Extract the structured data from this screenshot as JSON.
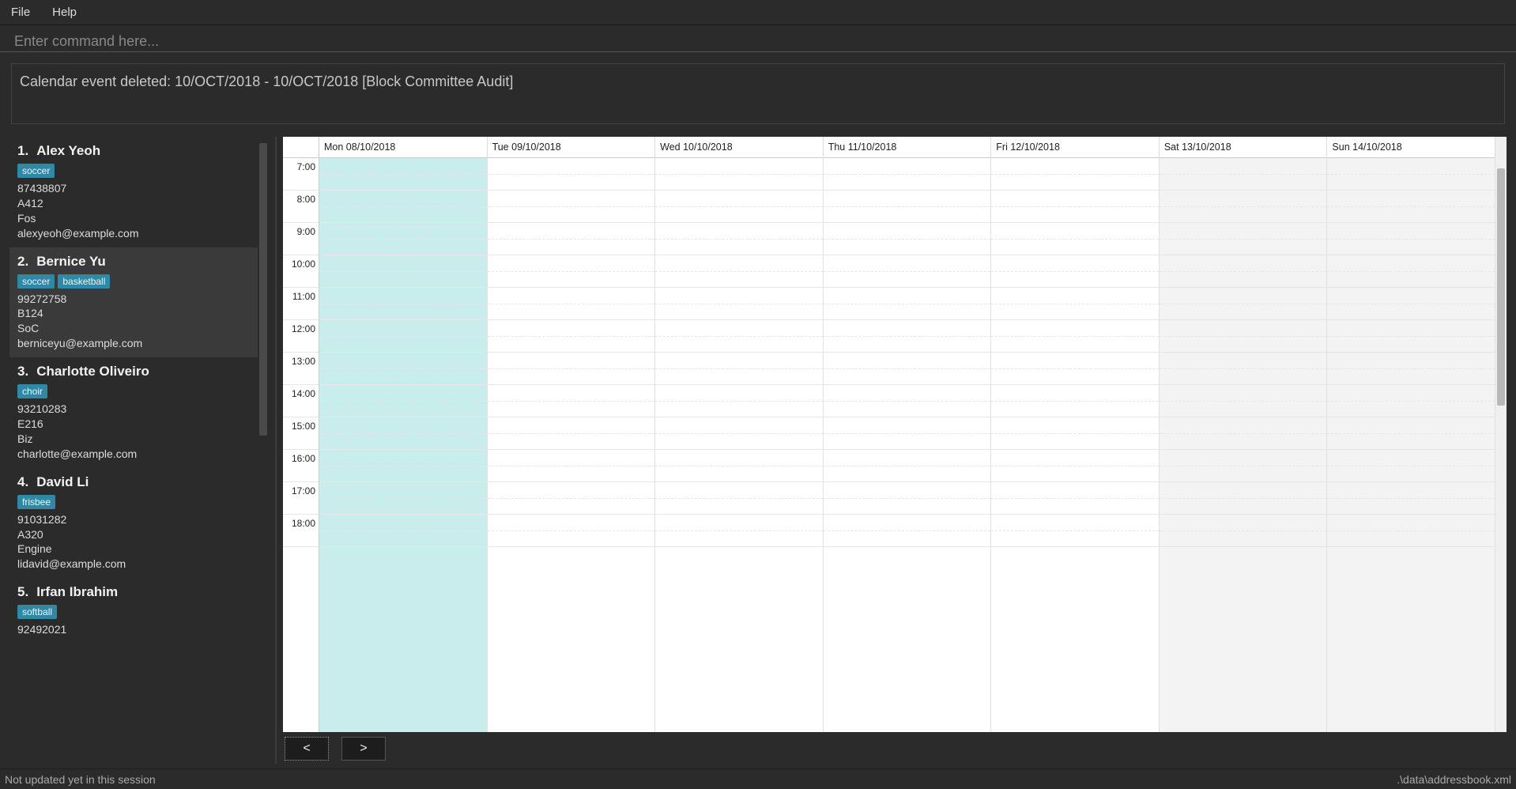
{
  "menu": {
    "file": "File",
    "help": "Help"
  },
  "command": {
    "placeholder": "Enter command here..."
  },
  "status": "Calendar event deleted: 10/OCT/2018 - 10/OCT/2018 [Block Committee Audit]",
  "people": [
    {
      "idx": "1.",
      "name": "Alex Yeoh",
      "tags": [
        "soccer"
      ],
      "phone": "87438807",
      "room": "A412",
      "faculty": "Fos",
      "email": "alexyeoh@example.com",
      "selected": false
    },
    {
      "idx": "2.",
      "name": "Bernice Yu",
      "tags": [
        "soccer",
        "basketball"
      ],
      "phone": "99272758",
      "room": "B124",
      "faculty": "SoC",
      "email": "berniceyu@example.com",
      "selected": true
    },
    {
      "idx": "3.",
      "name": "Charlotte Oliveiro",
      "tags": [
        "choir"
      ],
      "phone": "93210283",
      "room": "E216",
      "faculty": "Biz",
      "email": "charlotte@example.com",
      "selected": false
    },
    {
      "idx": "4.",
      "name": "David Li",
      "tags": [
        "frisbee"
      ],
      "phone": "91031282",
      "room": "A320",
      "faculty": "Engine",
      "email": "lidavid@example.com",
      "selected": false
    },
    {
      "idx": "5.",
      "name": "Irfan Ibrahim",
      "tags": [
        "softball"
      ],
      "phone": "92492021",
      "room": "",
      "faculty": "",
      "email": "",
      "selected": false
    }
  ],
  "calendar": {
    "days": [
      {
        "label": "Mon 08/10/2018",
        "kind": "today"
      },
      {
        "label": "Tue 09/10/2018",
        "kind": "weekday"
      },
      {
        "label": "Wed 10/10/2018",
        "kind": "weekday"
      },
      {
        "label": "Thu 11/10/2018",
        "kind": "weekday"
      },
      {
        "label": "Fri 12/10/2018",
        "kind": "weekday"
      },
      {
        "label": "Sat 13/10/2018",
        "kind": "weekend"
      },
      {
        "label": "Sun 14/10/2018",
        "kind": "weekend"
      }
    ],
    "hours": [
      "7:00",
      "8:00",
      "9:00",
      "10:00",
      "11:00",
      "12:00",
      "13:00",
      "14:00",
      "15:00",
      "16:00",
      "17:00",
      "18:00"
    ],
    "nav": {
      "prev": "<",
      "next": ">"
    }
  },
  "footer": {
    "left": "Not updated yet in this session",
    "right": ".\\data\\addressbook.xml"
  }
}
